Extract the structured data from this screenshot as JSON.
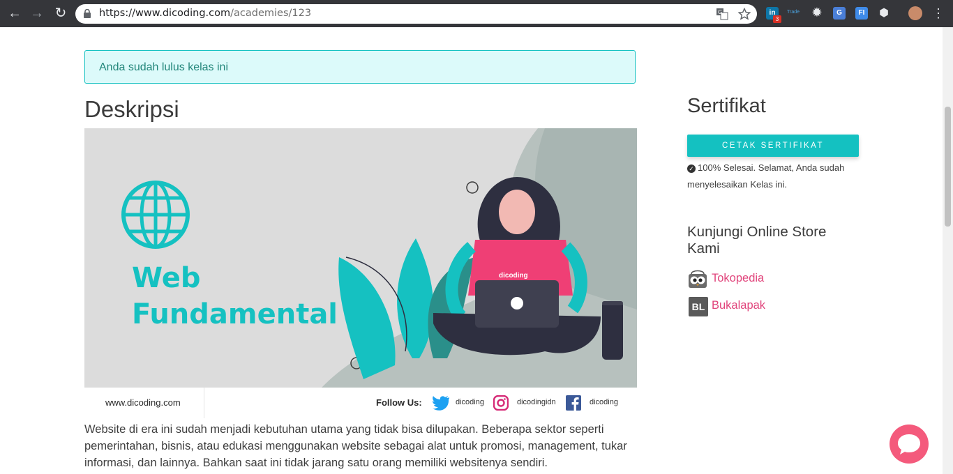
{
  "browser": {
    "url_host": "https://www.dicoding.com",
    "url_path": "/academies/123",
    "extension_badge": "3",
    "extension_text": "Trade"
  },
  "alert": {
    "text": "Anda sudah lulus kelas ini"
  },
  "description": {
    "heading": "Deskripsi"
  },
  "banner": {
    "title_line1": "Web",
    "title_line2": "Fundamental",
    "laptop_brand": "dicoding",
    "site": "www.dicoding.com",
    "follow_label": "Follow Us:",
    "twitter": "dicoding",
    "instagram": "dicodingidn",
    "facebook": "dicoding"
  },
  "body_text": "Website di era ini sudah menjadi kebutuhan utama yang tidak bisa dilupakan. Beberapa sektor seperti pemerintahan, bisnis, atau edukasi menggunakan website sebagai alat untuk promosi, management, tukar informasi, dan lainnya. Bahkan saat ini tidak jarang satu orang memiliki websitenya sendiri.",
  "sidebar": {
    "cert_heading": "Sertifikat",
    "cert_button": "CETAK SERTIFIKAT",
    "cert_status": "100% Selesai. Selamat, Anda sudah menyelesaikan Kelas ini.",
    "store_heading": "Kunjungi Online Store Kami",
    "stores": [
      {
        "label": "Tokopedia",
        "icon": "tokopedia-icon"
      },
      {
        "label": "Bukalapak",
        "icon": "bukalapak-icon",
        "icon_text": "BL"
      }
    ]
  },
  "colors": {
    "accent": "#14c1c1",
    "link": "#e1457c",
    "chat": "#f45a7c",
    "alert_bg": "#dcfafa"
  }
}
